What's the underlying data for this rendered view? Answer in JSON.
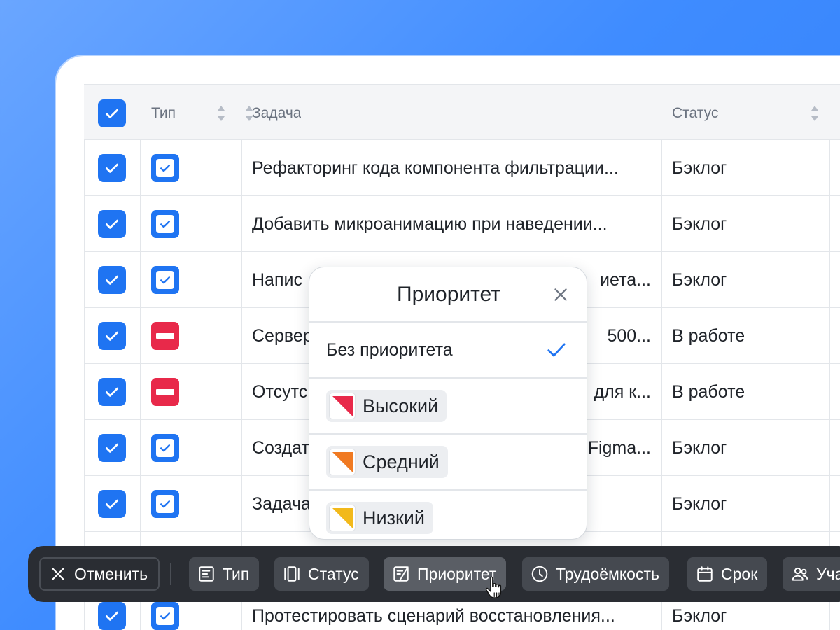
{
  "table": {
    "columns": {
      "type": "Тип",
      "task": "Задача",
      "status": "Статус"
    },
    "rows": [
      {
        "type": "task",
        "task": "Рефакторинг кода компонента фильтрации...",
        "status": "Бэклог"
      },
      {
        "type": "task",
        "task": "Добавить микроанимацию при наведении...",
        "status": "Бэклог"
      },
      {
        "type": "task",
        "task": "Напис",
        "task_tail": "иета...",
        "status": "Бэклог"
      },
      {
        "type": "bug",
        "task": "Сервер",
        "task_tail": "500...",
        "status": "В работе"
      },
      {
        "type": "bug",
        "task": "Отсутс",
        "task_tail": "для к...",
        "status": "В работе"
      },
      {
        "type": "task",
        "task": "Создат",
        "task_tail": "Figma...",
        "status": "Бэклог"
      },
      {
        "type": "task",
        "task": "Задача",
        "task_tail": "",
        "status": "Бэклог"
      },
      {
        "type": "task",
        "task": "Протестировать сценарий восстановления...",
        "status": "Бэклог"
      }
    ]
  },
  "priority_popup": {
    "title": "Приоритет",
    "options": [
      {
        "label": "Без приоритета",
        "selected": true
      },
      {
        "label": "Высокий",
        "color": "#e8294a"
      },
      {
        "label": "Средний",
        "color": "#f07a22"
      },
      {
        "label": "Низкий",
        "color": "#f2b91b"
      }
    ]
  },
  "toolbar": {
    "cancel": "Отменить",
    "type": "Тип",
    "status": "Статус",
    "priority": "Приоритет",
    "effort": "Трудоёмкость",
    "due": "Срок",
    "participants": "Уча"
  },
  "colors": {
    "accent": "#1f74f2",
    "bug": "#e8294a",
    "toolbar_bg": "#2a2d33"
  }
}
